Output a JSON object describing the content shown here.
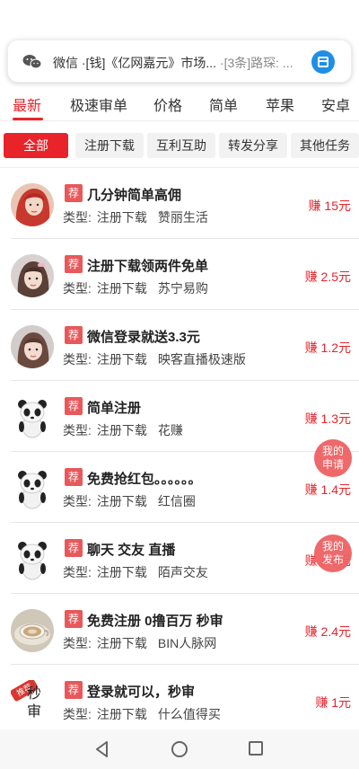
{
  "notification": {
    "app": "微信",
    "message": "·[钱]《亿网嘉元》市场...",
    "extra": "·[3条]路琛: ...",
    "icons": {
      "app": "wechat-icon",
      "action": "open-window-icon"
    },
    "action_color": "#1f8fe5"
  },
  "tabs": [
    "最新",
    "极速审单",
    "价格",
    "简单",
    "苹果",
    "安卓"
  ],
  "chips": [
    "全部",
    "注册下载",
    "互利互助",
    "转发分享",
    "其他任务"
  ],
  "accent_color": "#e8232a",
  "items": [
    {
      "badge": "荐",
      "title": "几分钟简单高佣",
      "type_label": "类型:",
      "type": "注册下载",
      "app": "赞丽生活",
      "reward": "赚 15元",
      "avatar": "girl-red-hair-avatar"
    },
    {
      "badge": "荐",
      "title": "注册下载领两件免单",
      "type_label": "类型:",
      "type": "注册下载",
      "app": "苏宁易购",
      "reward": "赚 2.5元",
      "avatar": "girl-photo-avatar"
    },
    {
      "badge": "荐",
      "title": "微信登录就送3.3元",
      "type_label": "类型:",
      "type": "注册下载",
      "app": "映客直播极速版",
      "reward": "赚 1.2元",
      "avatar": "girl-photo-avatar"
    },
    {
      "badge": "荐",
      "title": "简单注册",
      "type_label": "类型:",
      "type": "注册下载",
      "app": "花赚",
      "reward": "赚 1.3元",
      "avatar": "panda-avatar"
    },
    {
      "badge": "荐",
      "title": "免费抢红包。。。。。。",
      "type_label": "类型:",
      "type": "注册下载",
      "app": "红信圈",
      "reward": "赚 1.4元",
      "avatar": "panda-avatar"
    },
    {
      "badge": "荐",
      "title": "聊天 交友 直播",
      "type_label": "类型:",
      "type": "注册下载",
      "app": "陌声交友",
      "reward": "赚 1.6元",
      "avatar": "panda-avatar"
    },
    {
      "badge": "荐",
      "title": "免费注册 0撸百万 秒审",
      "type_label": "类型:",
      "type": "注册下载",
      "app": "BIN人脉网",
      "reward": "赚 2.4元",
      "avatar": "coffee-cup-avatar"
    },
    {
      "badge": "荐",
      "title": "登录就可以，秒审",
      "type_label": "类型:",
      "type": "注册下载",
      "app": "什么值得买",
      "reward": "赚 1元",
      "avatar": "seal-text-avatar",
      "avatar_text": "秒审",
      "avatar_ribbon": "推荐"
    }
  ],
  "fabs": {
    "my_apply": "我的申请",
    "my_publish": "我的发布"
  },
  "navbar": {
    "back": "back-icon",
    "home": "home-icon",
    "recent": "recent-apps-icon"
  }
}
